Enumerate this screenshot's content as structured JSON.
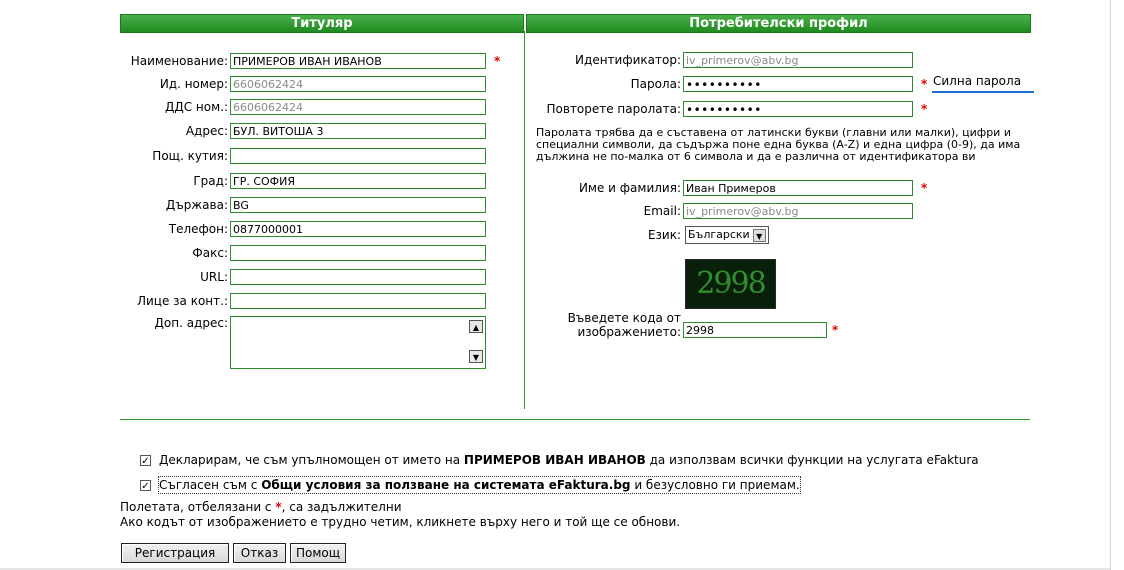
{
  "headers": {
    "left": "Титуляр",
    "right": "Потребителски профил"
  },
  "holder": {
    "name_label": "Наименование:",
    "name_value": "ПРИМЕРОВ ИВАН ИВАНОВ",
    "id_label": "Ид. номер:",
    "id_value": "6606062424",
    "vat_label": "ДДС ном.:",
    "vat_value": "6606062424",
    "address_label": "Адрес:",
    "address_value": "БУЛ. ВИТОША 3",
    "pobox_label": "Пощ. кутия:",
    "pobox_value": "",
    "city_label": "Град:",
    "city_value": "ГР. СОФИЯ",
    "country_label": "Държава:",
    "country_value": "BG",
    "phone_label": "Телефон:",
    "phone_value": "0877000001",
    "fax_label": "Факс:",
    "fax_value": "",
    "url_label": "URL:",
    "url_value": "",
    "contact_label": "Лице за конт.:",
    "contact_value": "",
    "extra_address_label": "Доп. адрес:",
    "extra_address_value": ""
  },
  "profile": {
    "identifier_label": "Идентификатор:",
    "identifier_value": "iv_primerov@abv.bg",
    "password_label": "Парола:",
    "password_value": "••••••••••",
    "password_strength": "Силна парола",
    "repeat_label": "Повторете паролата:",
    "repeat_value": "••••••••••",
    "password_note": "Паролата трябва да е съставена от латински букви (главни или малки), цифри и специални символи, да съдържа поне една буква (A-Z) и една цифра (0-9), да има дължина не по-малка от 6 символа и да е различна от идентификатора ви",
    "fullname_label": "Име и фамилия:",
    "fullname_value": "Иван Примеров",
    "email_label": "Email:",
    "email_value": "iv_primerov@abv.bg",
    "language_label": "Език:",
    "language_value": "Български",
    "captcha_text": "2998",
    "captcha_label_1": "Въведете кода от",
    "captcha_label_2": "изображението:",
    "captcha_value": "2998"
  },
  "required_mark": "*",
  "declaration": {
    "prefix": "Декларирам, че съм упълномощен от името на ",
    "name": "ПРИМЕРОВ ИВАН ИВАНОВ",
    "suffix": " да използвам всички функции на услугата eFaktura",
    "checked": true
  },
  "terms": {
    "prefix": "Съгласен съм с ",
    "link": "Общи условия за ползване на системата eFaktura.bg",
    "suffix": " и безусловно ги приемам.",
    "checked": true
  },
  "notes": {
    "required_prefix": "Полетата, отбелязани с ",
    "required_star": "*",
    "required_suffix": ", са задължителни",
    "captcha_hint": "Ако кодът от изображението е трудно четим, кликнете върху него и той ще се обнови."
  },
  "buttons": {
    "register": "Регистрация",
    "cancel": "Отказ",
    "help": "Помощ"
  },
  "check_glyph": "✓",
  "colors": {
    "header_green": "#2e9a2e",
    "required_red": "#e00000",
    "strength_blue": "#1e6fd0"
  }
}
